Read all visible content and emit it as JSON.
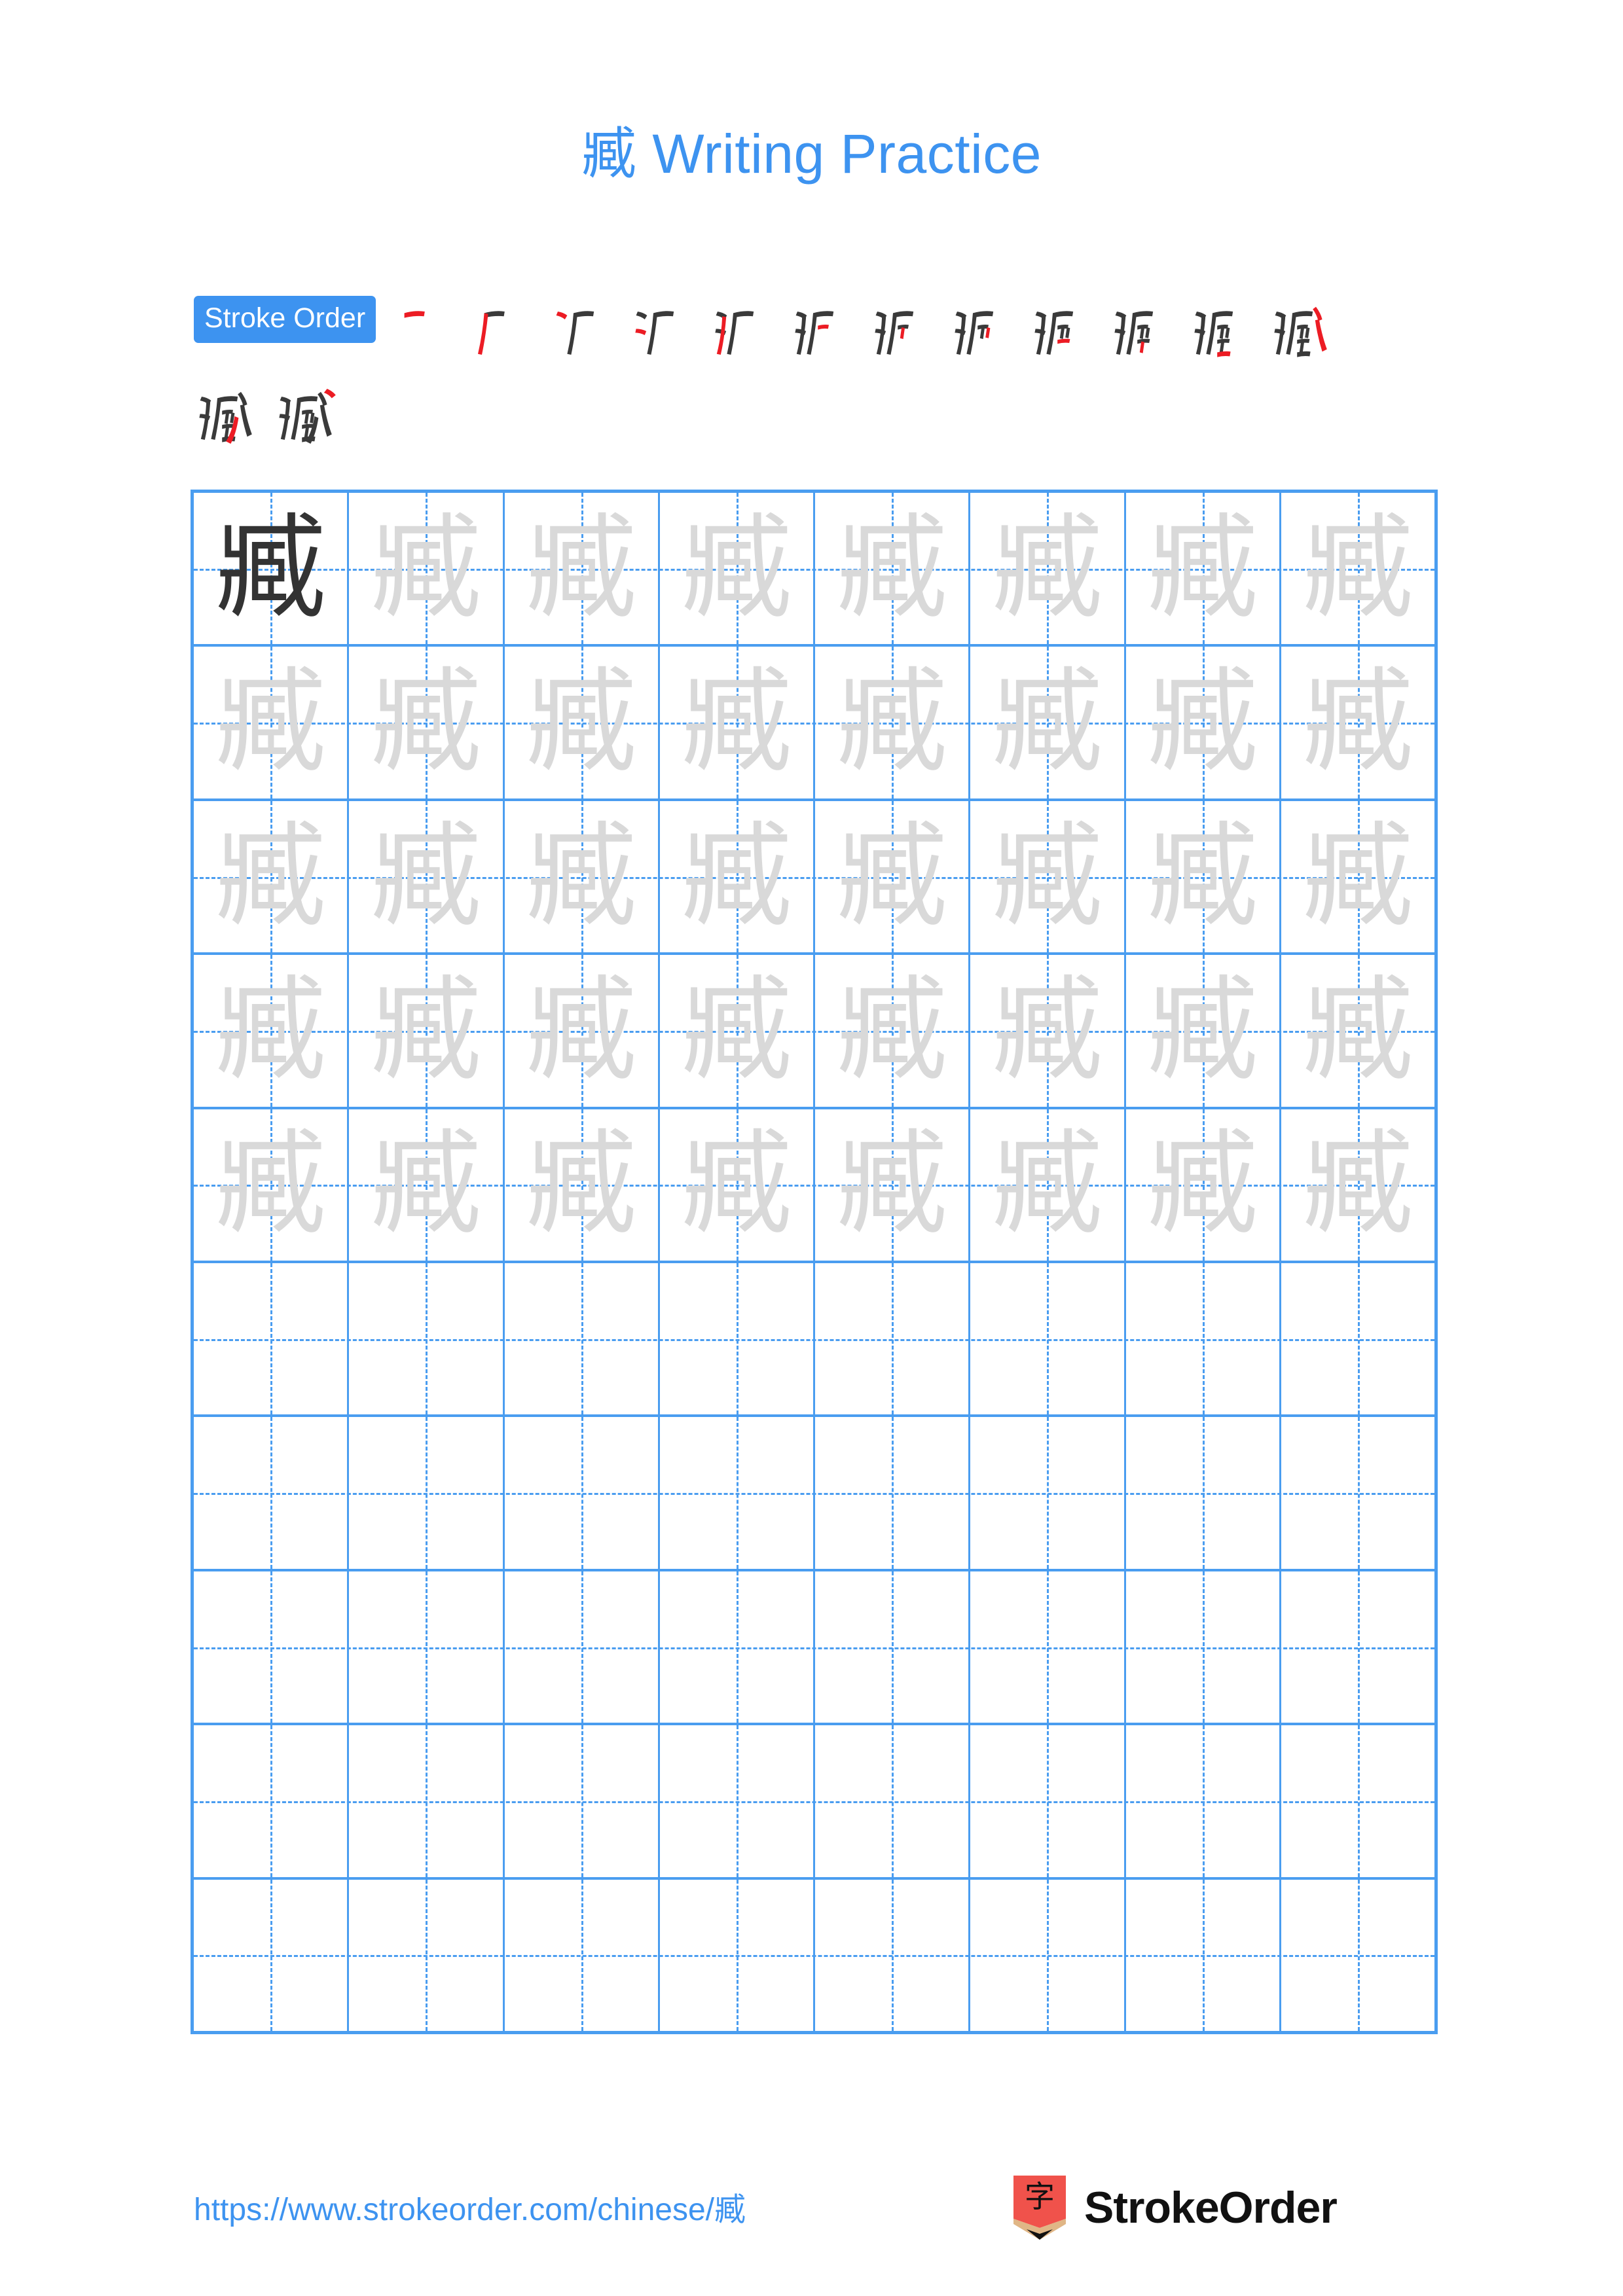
{
  "character": "臧",
  "header": {
    "title": "臧 Writing Practice"
  },
  "stroke_order": {
    "badge_label": "Stroke Order",
    "total_strokes": 14,
    "newest_stroke_color": "#ec1c24",
    "completed_stroke_color": "#3a3a3a",
    "steps": [
      {
        "index": 1,
        "strokes_shown": 1
      },
      {
        "index": 2,
        "strokes_shown": 2
      },
      {
        "index": 3,
        "strokes_shown": 3
      },
      {
        "index": 4,
        "strokes_shown": 4
      },
      {
        "index": 5,
        "strokes_shown": 5
      },
      {
        "index": 6,
        "strokes_shown": 6
      },
      {
        "index": 7,
        "strokes_shown": 7
      },
      {
        "index": 8,
        "strokes_shown": 8
      },
      {
        "index": 9,
        "strokes_shown": 9
      },
      {
        "index": 10,
        "strokes_shown": 10
      },
      {
        "index": 11,
        "strokes_shown": 11
      },
      {
        "index": 12,
        "strokes_shown": 12
      },
      {
        "index": 13,
        "strokes_shown": 13
      },
      {
        "index": 14,
        "strokes_shown": 14
      }
    ]
  },
  "practice_grid": {
    "rows": 10,
    "columns": 8,
    "grid_line_color": "#4a9df0",
    "model_char_color": "#333333",
    "trace_char_color": "#d9d9d9",
    "cells": [
      [
        "model",
        "trace",
        "trace",
        "trace",
        "trace",
        "trace",
        "trace",
        "trace"
      ],
      [
        "trace",
        "trace",
        "trace",
        "trace",
        "trace",
        "trace",
        "trace",
        "trace"
      ],
      [
        "trace",
        "trace",
        "trace",
        "trace",
        "trace",
        "trace",
        "trace",
        "trace"
      ],
      [
        "trace",
        "trace",
        "trace",
        "trace",
        "trace",
        "trace",
        "trace",
        "trace"
      ],
      [
        "trace",
        "trace",
        "trace",
        "trace",
        "trace",
        "trace",
        "trace",
        "trace"
      ],
      [
        "empty",
        "empty",
        "empty",
        "empty",
        "empty",
        "empty",
        "empty",
        "empty"
      ],
      [
        "empty",
        "empty",
        "empty",
        "empty",
        "empty",
        "empty",
        "empty",
        "empty"
      ],
      [
        "empty",
        "empty",
        "empty",
        "empty",
        "empty",
        "empty",
        "empty",
        "empty"
      ],
      [
        "empty",
        "empty",
        "empty",
        "empty",
        "empty",
        "empty",
        "empty",
        "empty"
      ],
      [
        "empty",
        "empty",
        "empty",
        "empty",
        "empty",
        "empty",
        "empty",
        "empty"
      ]
    ]
  },
  "footer": {
    "url": "https://www.strokeorder.com/chinese/臧",
    "brand_name": "StrokeOrder",
    "logo_char": "字",
    "logo_color": "#f0524b",
    "logo_tip_color": "#e0b686"
  }
}
